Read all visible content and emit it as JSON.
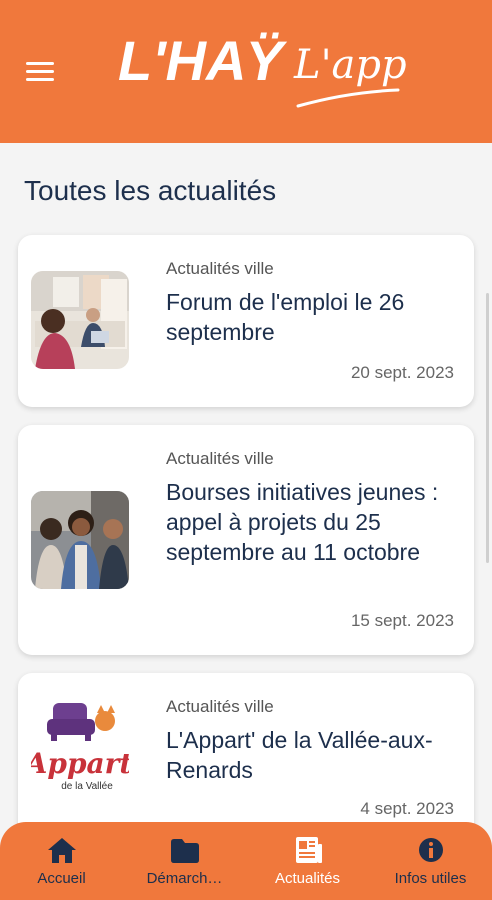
{
  "header": {
    "menu_icon": "hamburger-menu-icon",
    "logo_main": "L'HAŸ",
    "logo_sub": "L'appli"
  },
  "page": {
    "title": "Toutes les actualités"
  },
  "news": [
    {
      "category": "Actualités ville",
      "title": "Forum de l'emploi le 26 septembre",
      "date": "20 sept. 2023",
      "image": "job-fair-photo"
    },
    {
      "category": "Actualités ville",
      "title": "Bourses initiatives jeunes : appel à projets du 25 septembre au 11 octobre",
      "date": "15 sept. 2023",
      "image": "young-people-photo"
    },
    {
      "category": "Actualités ville",
      "title": "L'Appart' de la Vallée-aux-Renards",
      "date": "4 sept. 2023",
      "image": "appart-logo",
      "image_text": "Appart",
      "image_subtext": "de la Vallée"
    }
  ],
  "bottom_nav": [
    {
      "label": "Accueil",
      "icon": "home-icon",
      "active": false
    },
    {
      "label": "Démarch…",
      "icon": "folder-icon",
      "active": false
    },
    {
      "label": "Actualités",
      "icon": "newspaper-icon",
      "active": true
    },
    {
      "label": "Infos utiles",
      "icon": "info-icon",
      "active": false
    }
  ],
  "colors": {
    "brand_orange": "#f0783c",
    "navy": "#1d2f4c"
  }
}
